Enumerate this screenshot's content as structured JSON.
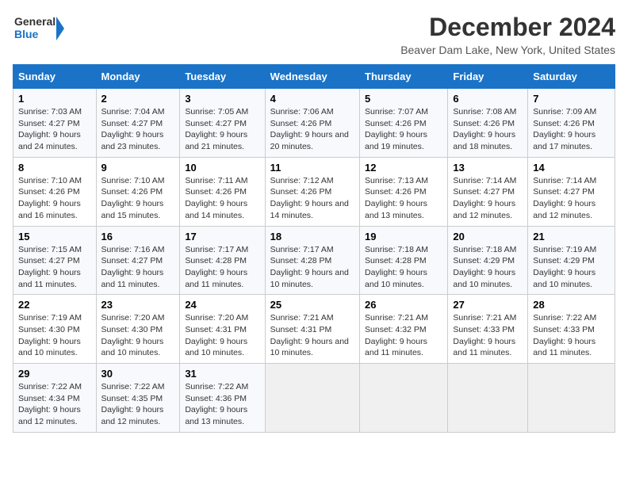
{
  "logo": {
    "line1": "General",
    "line2": "Blue"
  },
  "title": "December 2024",
  "subtitle": "Beaver Dam Lake, New York, United States",
  "colors": {
    "header_bg": "#1a73c7"
  },
  "weekdays": [
    "Sunday",
    "Monday",
    "Tuesday",
    "Wednesday",
    "Thursday",
    "Friday",
    "Saturday"
  ],
  "weeks": [
    [
      {
        "day": "1",
        "sunrise": "Sunrise: 7:03 AM",
        "sunset": "Sunset: 4:27 PM",
        "daylight": "Daylight: 9 hours and 24 minutes."
      },
      {
        "day": "2",
        "sunrise": "Sunrise: 7:04 AM",
        "sunset": "Sunset: 4:27 PM",
        "daylight": "Daylight: 9 hours and 23 minutes."
      },
      {
        "day": "3",
        "sunrise": "Sunrise: 7:05 AM",
        "sunset": "Sunset: 4:27 PM",
        "daylight": "Daylight: 9 hours and 21 minutes."
      },
      {
        "day": "4",
        "sunrise": "Sunrise: 7:06 AM",
        "sunset": "Sunset: 4:26 PM",
        "daylight": "Daylight: 9 hours and 20 minutes."
      },
      {
        "day": "5",
        "sunrise": "Sunrise: 7:07 AM",
        "sunset": "Sunset: 4:26 PM",
        "daylight": "Daylight: 9 hours and 19 minutes."
      },
      {
        "day": "6",
        "sunrise": "Sunrise: 7:08 AM",
        "sunset": "Sunset: 4:26 PM",
        "daylight": "Daylight: 9 hours and 18 minutes."
      },
      {
        "day": "7",
        "sunrise": "Sunrise: 7:09 AM",
        "sunset": "Sunset: 4:26 PM",
        "daylight": "Daylight: 9 hours and 17 minutes."
      }
    ],
    [
      {
        "day": "8",
        "sunrise": "Sunrise: 7:10 AM",
        "sunset": "Sunset: 4:26 PM",
        "daylight": "Daylight: 9 hours and 16 minutes."
      },
      {
        "day": "9",
        "sunrise": "Sunrise: 7:10 AM",
        "sunset": "Sunset: 4:26 PM",
        "daylight": "Daylight: 9 hours and 15 minutes."
      },
      {
        "day": "10",
        "sunrise": "Sunrise: 7:11 AM",
        "sunset": "Sunset: 4:26 PM",
        "daylight": "Daylight: 9 hours and 14 minutes."
      },
      {
        "day": "11",
        "sunrise": "Sunrise: 7:12 AM",
        "sunset": "Sunset: 4:26 PM",
        "daylight": "Daylight: 9 hours and 14 minutes."
      },
      {
        "day": "12",
        "sunrise": "Sunrise: 7:13 AM",
        "sunset": "Sunset: 4:26 PM",
        "daylight": "Daylight: 9 hours and 13 minutes."
      },
      {
        "day": "13",
        "sunrise": "Sunrise: 7:14 AM",
        "sunset": "Sunset: 4:27 PM",
        "daylight": "Daylight: 9 hours and 12 minutes."
      },
      {
        "day": "14",
        "sunrise": "Sunrise: 7:14 AM",
        "sunset": "Sunset: 4:27 PM",
        "daylight": "Daylight: 9 hours and 12 minutes."
      }
    ],
    [
      {
        "day": "15",
        "sunrise": "Sunrise: 7:15 AM",
        "sunset": "Sunset: 4:27 PM",
        "daylight": "Daylight: 9 hours and 11 minutes."
      },
      {
        "day": "16",
        "sunrise": "Sunrise: 7:16 AM",
        "sunset": "Sunset: 4:27 PM",
        "daylight": "Daylight: 9 hours and 11 minutes."
      },
      {
        "day": "17",
        "sunrise": "Sunrise: 7:17 AM",
        "sunset": "Sunset: 4:28 PM",
        "daylight": "Daylight: 9 hours and 11 minutes."
      },
      {
        "day": "18",
        "sunrise": "Sunrise: 7:17 AM",
        "sunset": "Sunset: 4:28 PM",
        "daylight": "Daylight: 9 hours and 10 minutes."
      },
      {
        "day": "19",
        "sunrise": "Sunrise: 7:18 AM",
        "sunset": "Sunset: 4:28 PM",
        "daylight": "Daylight: 9 hours and 10 minutes."
      },
      {
        "day": "20",
        "sunrise": "Sunrise: 7:18 AM",
        "sunset": "Sunset: 4:29 PM",
        "daylight": "Daylight: 9 hours and 10 minutes."
      },
      {
        "day": "21",
        "sunrise": "Sunrise: 7:19 AM",
        "sunset": "Sunset: 4:29 PM",
        "daylight": "Daylight: 9 hours and 10 minutes."
      }
    ],
    [
      {
        "day": "22",
        "sunrise": "Sunrise: 7:19 AM",
        "sunset": "Sunset: 4:30 PM",
        "daylight": "Daylight: 9 hours and 10 minutes."
      },
      {
        "day": "23",
        "sunrise": "Sunrise: 7:20 AM",
        "sunset": "Sunset: 4:30 PM",
        "daylight": "Daylight: 9 hours and 10 minutes."
      },
      {
        "day": "24",
        "sunrise": "Sunrise: 7:20 AM",
        "sunset": "Sunset: 4:31 PM",
        "daylight": "Daylight: 9 hours and 10 minutes."
      },
      {
        "day": "25",
        "sunrise": "Sunrise: 7:21 AM",
        "sunset": "Sunset: 4:31 PM",
        "daylight": "Daylight: 9 hours and 10 minutes."
      },
      {
        "day": "26",
        "sunrise": "Sunrise: 7:21 AM",
        "sunset": "Sunset: 4:32 PM",
        "daylight": "Daylight: 9 hours and 11 minutes."
      },
      {
        "day": "27",
        "sunrise": "Sunrise: 7:21 AM",
        "sunset": "Sunset: 4:33 PM",
        "daylight": "Daylight: 9 hours and 11 minutes."
      },
      {
        "day": "28",
        "sunrise": "Sunrise: 7:22 AM",
        "sunset": "Sunset: 4:33 PM",
        "daylight": "Daylight: 9 hours and 11 minutes."
      }
    ],
    [
      {
        "day": "29",
        "sunrise": "Sunrise: 7:22 AM",
        "sunset": "Sunset: 4:34 PM",
        "daylight": "Daylight: 9 hours and 12 minutes."
      },
      {
        "day": "30",
        "sunrise": "Sunrise: 7:22 AM",
        "sunset": "Sunset: 4:35 PM",
        "daylight": "Daylight: 9 hours and 12 minutes."
      },
      {
        "day": "31",
        "sunrise": "Sunrise: 7:22 AM",
        "sunset": "Sunset: 4:36 PM",
        "daylight": "Daylight: 9 hours and 13 minutes."
      },
      null,
      null,
      null,
      null
    ]
  ]
}
